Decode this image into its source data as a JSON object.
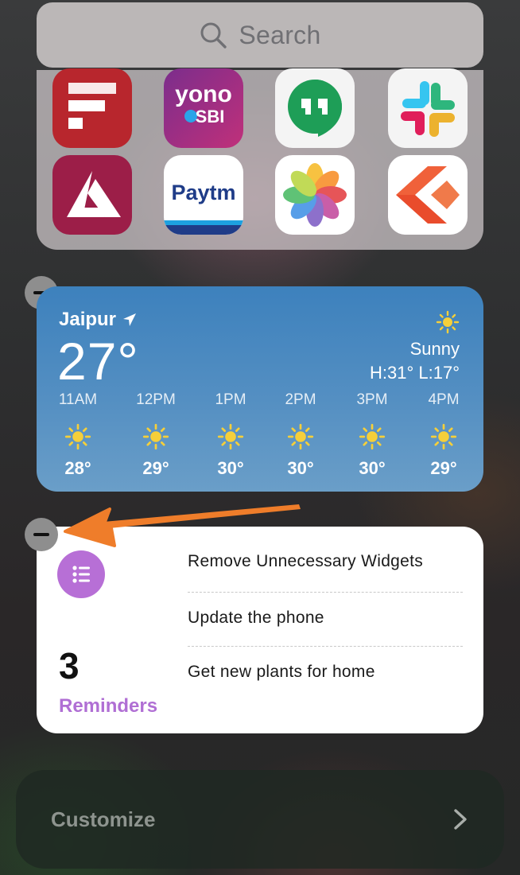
{
  "search": {
    "placeholder": "Search"
  },
  "apps": [
    {
      "name": "first-app-icon",
      "label": ""
    },
    {
      "name": "yono-sbi-app-icon",
      "label_top": "yono",
      "label_bottom": "SBI"
    },
    {
      "name": "hangouts-app-icon"
    },
    {
      "name": "slack-app-icon"
    },
    {
      "name": "axis-bank-app-icon"
    },
    {
      "name": "paytm-app-icon",
      "label": "Paytm"
    },
    {
      "name": "photos-app-icon"
    },
    {
      "name": "kite-app-icon"
    }
  ],
  "weather": {
    "city": "Jaipur",
    "temperature": "27°",
    "condition": "Sunny",
    "high_low": "H:31° L:17°",
    "hourly": [
      {
        "time": "11AM",
        "temp": "28°"
      },
      {
        "time": "12PM",
        "temp": "29°"
      },
      {
        "time": "1PM",
        "temp": "30°"
      },
      {
        "time": "2PM",
        "temp": "30°"
      },
      {
        "time": "3PM",
        "temp": "30°"
      },
      {
        "time": "4PM",
        "temp": "29°"
      }
    ],
    "sun_color": "#f5cf3a"
  },
  "reminders": {
    "count": "3",
    "label": "Reminders",
    "items": [
      "Remove Unnecessary Widgets",
      "Update the phone",
      "Get new plants for home"
    ],
    "accent": "#b76fd6"
  },
  "customize": {
    "label": "Customize"
  },
  "annotation": {
    "arrow_color": "#ef7d2a"
  }
}
